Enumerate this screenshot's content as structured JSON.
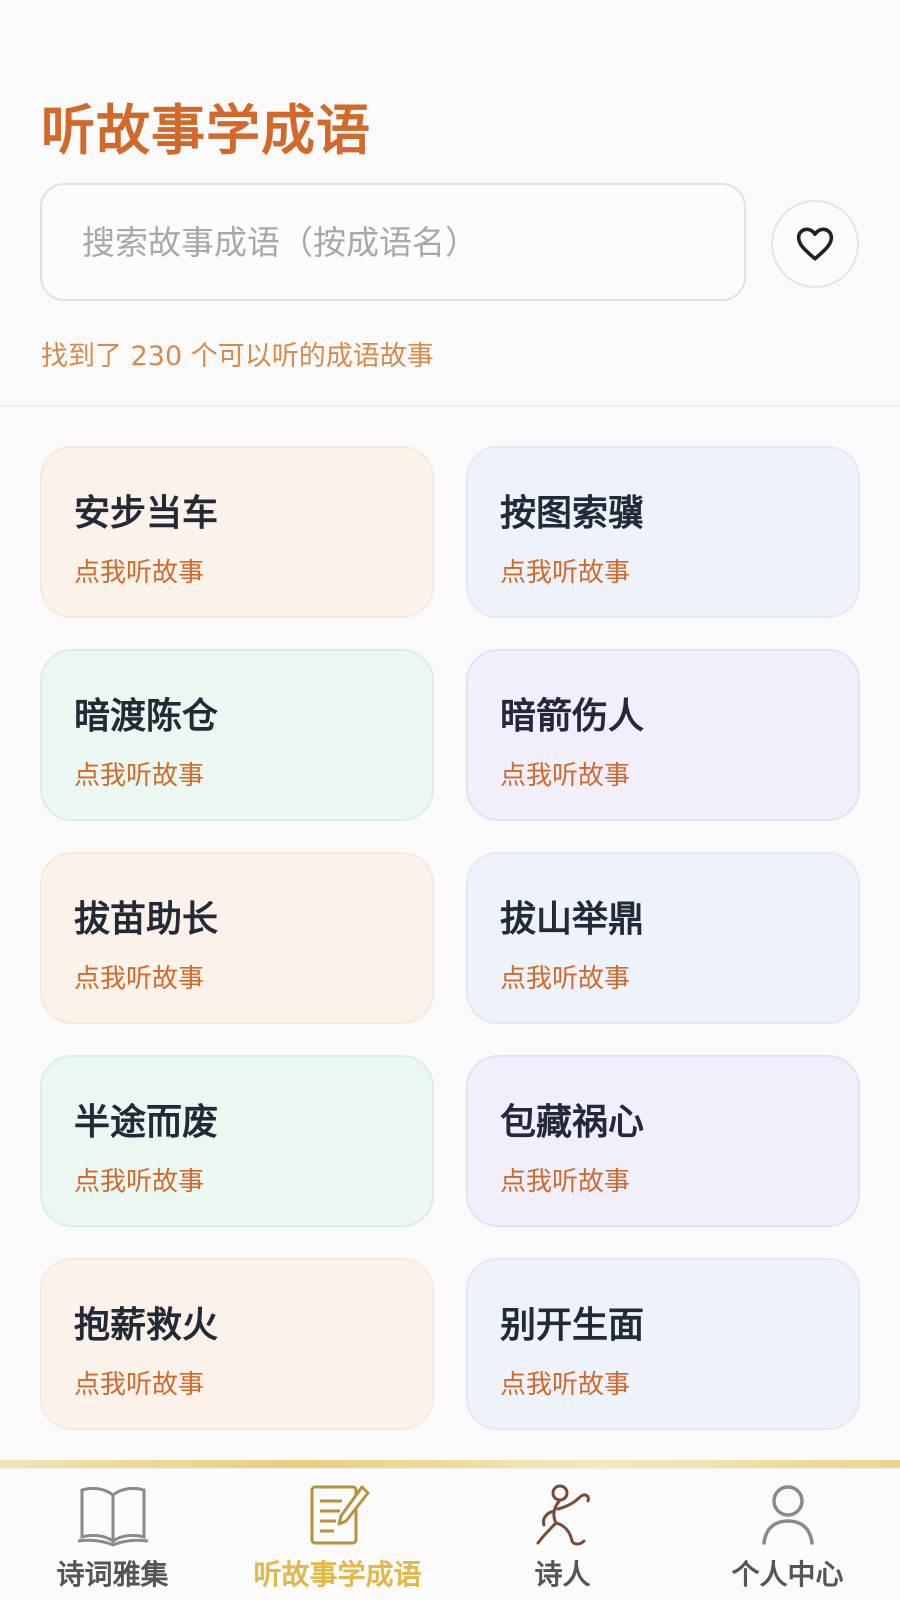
{
  "header": {
    "title": "听故事学成语",
    "search_placeholder": "搜索故事成语（按成语名）",
    "result_count": "找到了 230 个可以听的成语故事"
  },
  "cta_label": "点我听故事",
  "idioms": [
    {
      "name": "安步当车",
      "tone": "peach"
    },
    {
      "name": "按图索骥",
      "tone": "blue"
    },
    {
      "name": "暗渡陈仓",
      "tone": "green"
    },
    {
      "name": "暗箭伤人",
      "tone": "purple"
    },
    {
      "name": "拔苗助长",
      "tone": "peach"
    },
    {
      "name": "拔山举鼎",
      "tone": "blue"
    },
    {
      "name": "半途而废",
      "tone": "green"
    },
    {
      "name": "包藏祸心",
      "tone": "purple"
    },
    {
      "name": "抱薪救火",
      "tone": "peach"
    },
    {
      "name": "别开生面",
      "tone": "blue"
    }
  ],
  "tabs": [
    {
      "label": "诗词雅集",
      "icon": "book-icon",
      "active": false
    },
    {
      "label": "听故事学成语",
      "icon": "notepad-pen-icon",
      "active": true
    },
    {
      "label": "诗人",
      "icon": "poet-figure-icon",
      "active": false
    },
    {
      "label": "个人中心",
      "icon": "user-icon",
      "active": false
    }
  ],
  "colors": {
    "accent": "#d2692a",
    "tab_active": "#e2b84a",
    "text_dark": "#232a36"
  }
}
